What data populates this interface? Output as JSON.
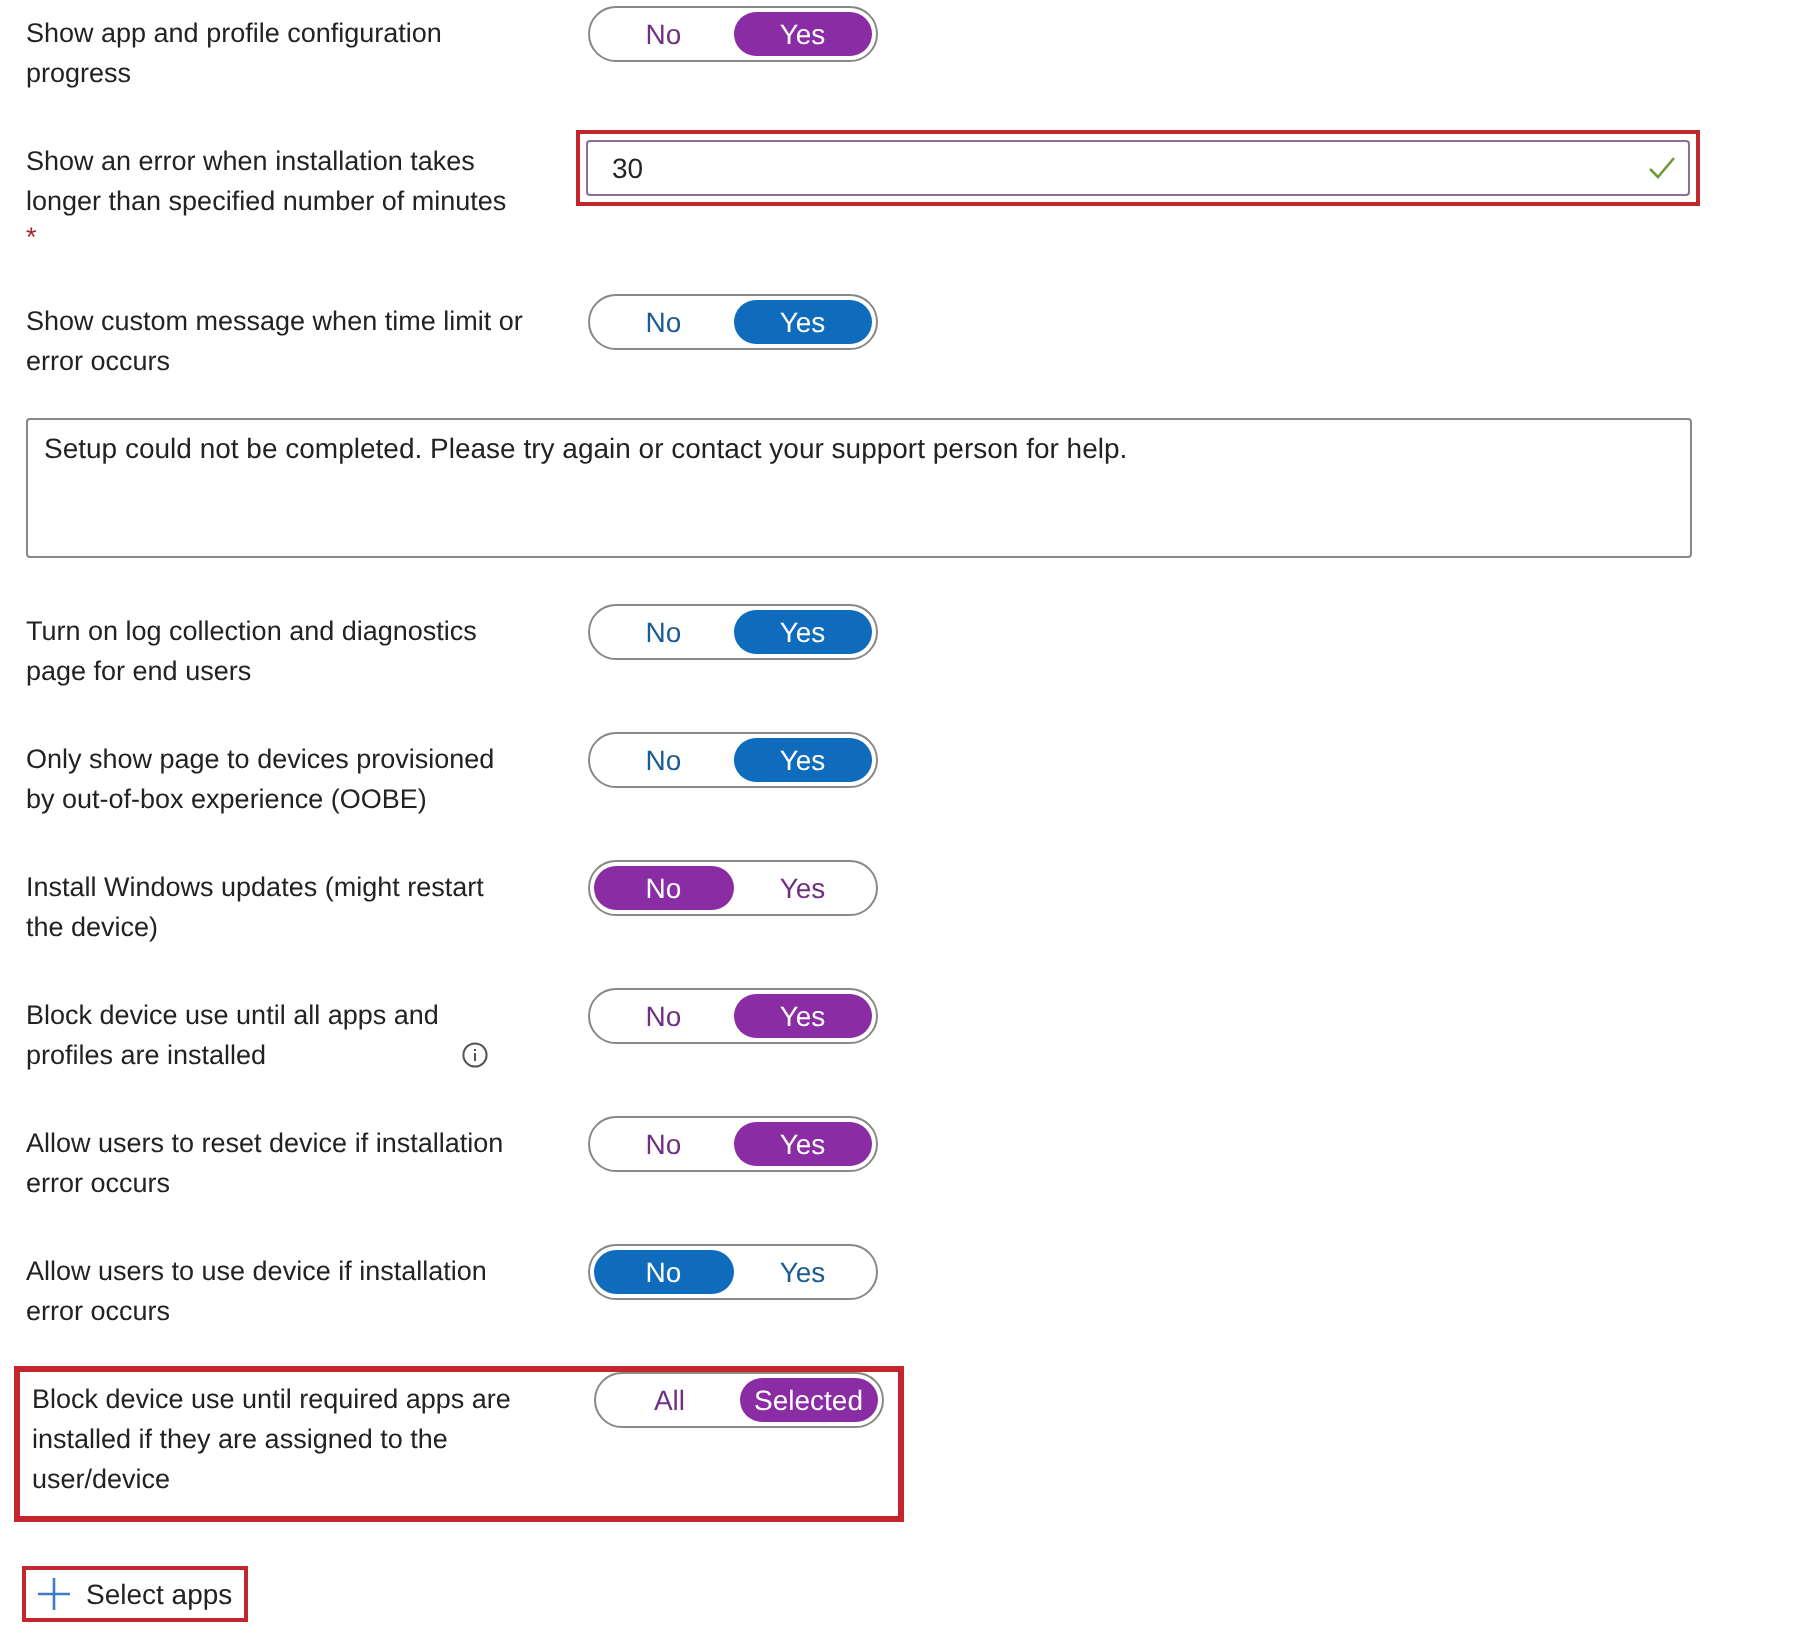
{
  "settings": [
    {
      "kind": "toggle",
      "label": "Show app and profile configuration progress",
      "color": "#8a2da5",
      "highlighted": false,
      "info_icon": false,
      "options": [
        {
          "label": "No",
          "selected": false
        },
        {
          "label": "Yes",
          "selected": true
        }
      ]
    },
    {
      "kind": "number_field",
      "label": "Show an error when installation takes longer than specified number of minutes",
      "required": true,
      "required_marker": "*",
      "value": "30",
      "valid": true,
      "highlighted": true
    },
    {
      "kind": "toggle",
      "label": "Show custom message when time limit or error occurs",
      "color": "#0f6cbd",
      "highlighted": false,
      "info_icon": false,
      "options": [
        {
          "label": "No",
          "selected": false
        },
        {
          "label": "Yes",
          "selected": true
        }
      ]
    },
    {
      "kind": "textarea",
      "value": "Setup could not be completed. Please try again or contact your support person for help."
    },
    {
      "kind": "toggle",
      "label": "Turn on log collection and diagnostics page for end users",
      "color": "#0f6cbd",
      "highlighted": false,
      "info_icon": false,
      "options": [
        {
          "label": "No",
          "selected": false
        },
        {
          "label": "Yes",
          "selected": true
        }
      ]
    },
    {
      "kind": "toggle",
      "label": "Only show page to devices provisioned by out-of-box experience (OOBE)",
      "color": "#0f6cbd",
      "highlighted": false,
      "info_icon": false,
      "options": [
        {
          "label": "No",
          "selected": false
        },
        {
          "label": "Yes",
          "selected": true
        }
      ]
    },
    {
      "kind": "toggle",
      "label": "Install Windows updates (might restart the device)",
      "color": "#8a2da5",
      "highlighted": false,
      "info_icon": false,
      "options": [
        {
          "label": "No",
          "selected": true
        },
        {
          "label": "Yes",
          "selected": false
        }
      ]
    },
    {
      "kind": "toggle",
      "label": "Block device use until all apps and profiles are installed",
      "color": "#8a2da5",
      "highlighted": false,
      "info_icon": true,
      "options": [
        {
          "label": "No",
          "selected": false
        },
        {
          "label": "Yes",
          "selected": true
        }
      ]
    },
    {
      "kind": "toggle",
      "label": "Allow users to reset device if installation error occurs",
      "color": "#8a2da5",
      "highlighted": false,
      "info_icon": false,
      "options": [
        {
          "label": "No",
          "selected": false
        },
        {
          "label": "Yes",
          "selected": true
        }
      ]
    },
    {
      "kind": "toggle",
      "label": "Allow users to use device if installation error occurs",
      "color": "#0f6cbd",
      "highlighted": false,
      "info_icon": false,
      "options": [
        {
          "label": "No",
          "selected": true
        },
        {
          "label": "Yes",
          "selected": false
        }
      ]
    },
    {
      "kind": "toggle",
      "label": "Block device use until required apps are installed if they are assigned to the user/device",
      "color": "#8a2da5",
      "highlighted": true,
      "info_icon": false,
      "options": [
        {
          "label": "All",
          "selected": false
        },
        {
          "label": "Selected",
          "selected": true
        }
      ]
    },
    {
      "kind": "add_link",
      "label": "Select apps",
      "highlighted": true
    }
  ]
}
